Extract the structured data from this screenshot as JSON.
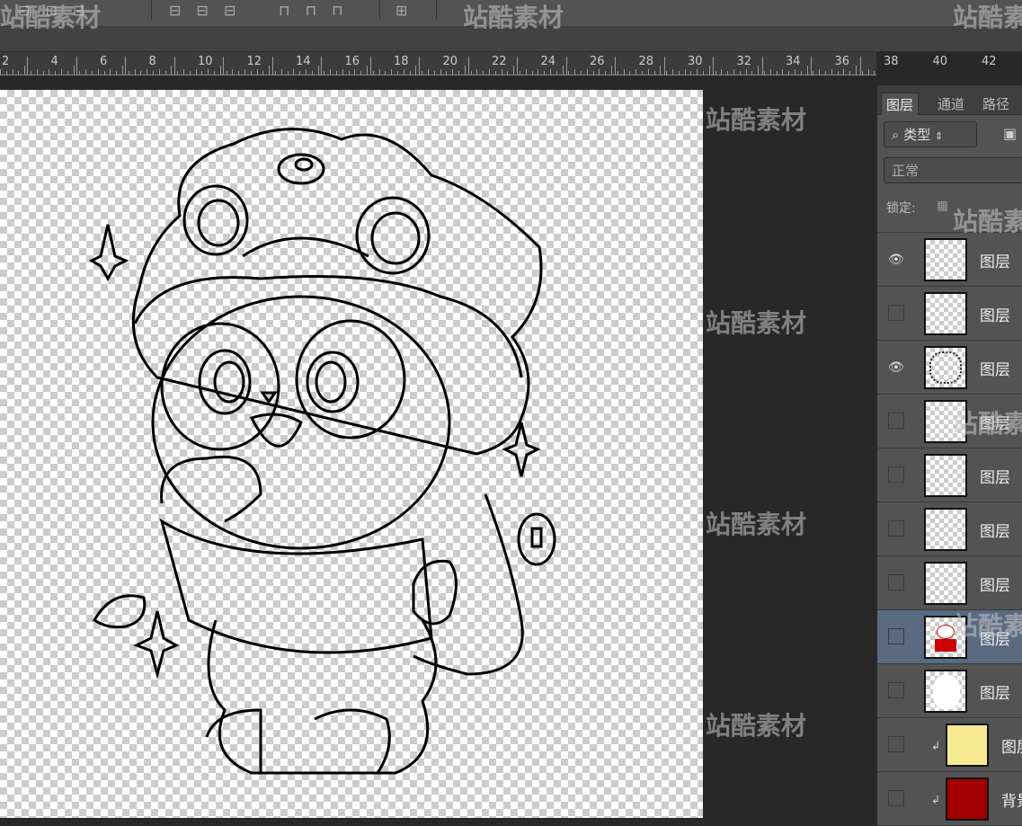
{
  "toolbar": {
    "glyphs": [
      "⊟ ⊞ ⊟",
      "⊟ ⊟ ⊟",
      "⊓ ⊓ ⊓",
      "⊞"
    ]
  },
  "ruler": {
    "labels": [
      "2",
      "4",
      "6",
      "8",
      "10",
      "12",
      "14",
      "16",
      "18",
      "20",
      "22",
      "24",
      "26",
      "28",
      "30",
      "32",
      "34",
      "36",
      "38",
      "40",
      "42"
    ]
  },
  "layers_panel": {
    "tabs": [
      "图层",
      "通道",
      "路径"
    ],
    "filter": {
      "icon": "search-icon",
      "label": "类型"
    },
    "blend_mode": "正常",
    "lock_label": "锁定:",
    "layers": [
      {
        "name": "图层",
        "visible": true,
        "selected": false,
        "clipped": false,
        "thumb": "transparent"
      },
      {
        "name": "图层",
        "visible": false,
        "selected": false,
        "clipped": false,
        "thumb": "transparent"
      },
      {
        "name": "图层",
        "visible": true,
        "selected": false,
        "clipped": false,
        "thumb": "sketch"
      },
      {
        "name": "图层",
        "visible": false,
        "selected": false,
        "clipped": false,
        "thumb": "transparent"
      },
      {
        "name": "图层",
        "visible": false,
        "selected": false,
        "clipped": false,
        "thumb": "transparent"
      },
      {
        "name": "图层",
        "visible": false,
        "selected": false,
        "clipped": false,
        "thumb": "transparent"
      },
      {
        "name": "图层",
        "visible": false,
        "selected": false,
        "clipped": false,
        "thumb": "transparent"
      },
      {
        "name": "图层",
        "visible": false,
        "selected": true,
        "clipped": false,
        "thumb": "color-panda"
      },
      {
        "name": "图层",
        "visible": false,
        "selected": false,
        "clipped": false,
        "thumb": "white"
      },
      {
        "name": "图层",
        "visible": false,
        "selected": false,
        "clipped": true,
        "thumb": "yellow"
      },
      {
        "name": "背景",
        "visible": false,
        "selected": false,
        "clipped": true,
        "thumb": "red"
      }
    ]
  },
  "watermark": "站酷素材",
  "colors": {
    "yellow": "#f5ea90",
    "red": "#a00000",
    "selected": "#5a6a80"
  }
}
